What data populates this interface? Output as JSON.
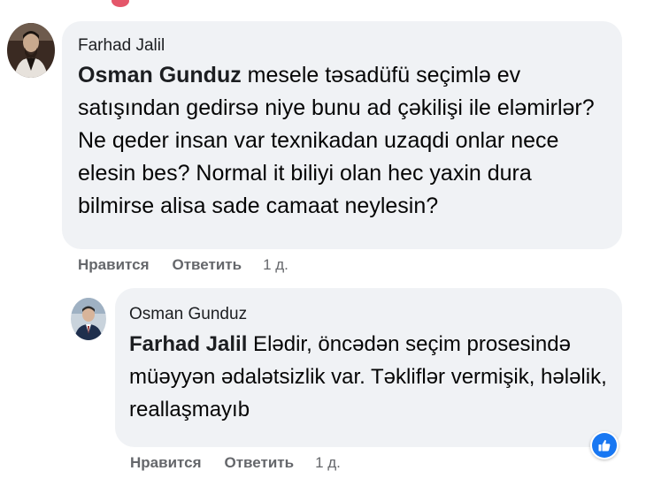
{
  "colors": {
    "bubble_bg": "#f0f2f5",
    "text": "#050505",
    "meta_text": "#65676b",
    "like_blue": "#1877f2"
  },
  "comment": {
    "author": "Farhad Jalil",
    "mention": "Osman Gunduz",
    "text": " mesele təsadüfü seçimlə ev satışından gedirsə niye bunu ad çəkilişi ile eləmirlər? Ne qeder insan var texnikadan uzaqdi onlar nece elesin bes? Normal it biliyi olan hec yaxin dura bilmirse alisa sade camaat neylesin?",
    "actions": {
      "like": "Нравится",
      "reply": "Ответить",
      "time": "1 д."
    }
  },
  "reply": {
    "author": "Osman Gunduz",
    "mention": "Farhad Jalil",
    "text": " Elədir, öncədən seçim prosesində müəyyən ədalətsizlik var. Təkliflər vermişik, hələlik, reallaşmayıb",
    "reaction_icon": "thumbs-up-icon",
    "actions": {
      "like": "Нравится",
      "reply": "Ответить",
      "time": "1 д."
    }
  }
}
